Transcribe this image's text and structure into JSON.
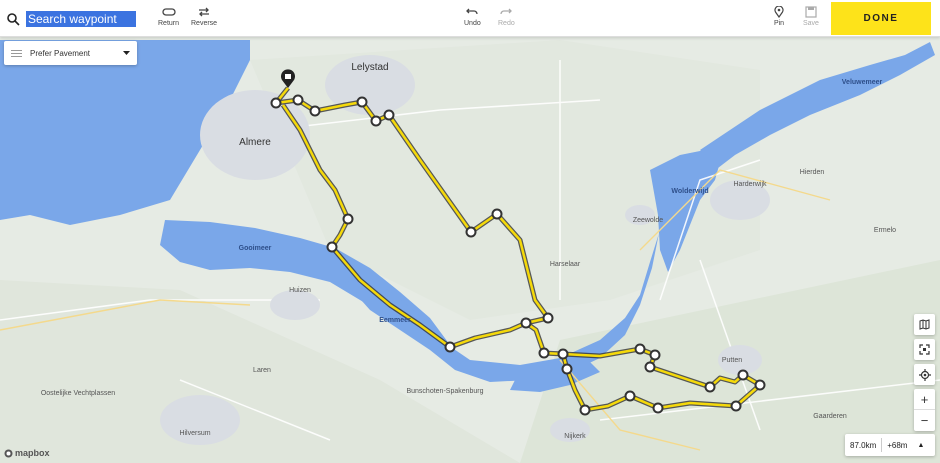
{
  "search": {
    "placeholder": "Search waypoint",
    "icon": "search-icon"
  },
  "toolbar": {
    "return_label": "Return",
    "reverse_label": "Reverse",
    "undo_label": "Undo",
    "redo_label": "Redo",
    "pin_label": "Pin",
    "save_label": "Save",
    "done_label": "DONE"
  },
  "preference": {
    "label": "Prefer Pavement"
  },
  "stats": {
    "distance": "87.0km",
    "elevation": "+68m"
  },
  "attribution": "mapbox",
  "colors": {
    "water": "#7aa7e9",
    "land": "#e8ece6",
    "route": "#f5d90a",
    "accent": "#fde31a"
  },
  "map_labels": [
    {
      "name": "Almere"
    },
    {
      "name": "Lelystad"
    },
    {
      "name": "Gooimeer"
    },
    {
      "name": "Eemmeer"
    },
    {
      "name": "Wolderwijd"
    },
    {
      "name": "Zeewolde"
    },
    {
      "name": "Huizen"
    },
    {
      "name": "Laren"
    },
    {
      "name": "Hilversum"
    },
    {
      "name": "Bunschoten-Spakenburg"
    },
    {
      "name": "Nijkerk"
    },
    {
      "name": "Putten"
    },
    {
      "name": "Harderwijk"
    },
    {
      "name": "Hierden"
    },
    {
      "name": "Veluwemeer"
    },
    {
      "name": "Gaarderen"
    },
    {
      "name": "Ermelo"
    },
    {
      "name": "Oostelijke Vechtplassen"
    },
    {
      "name": "Harselaar"
    }
  ]
}
